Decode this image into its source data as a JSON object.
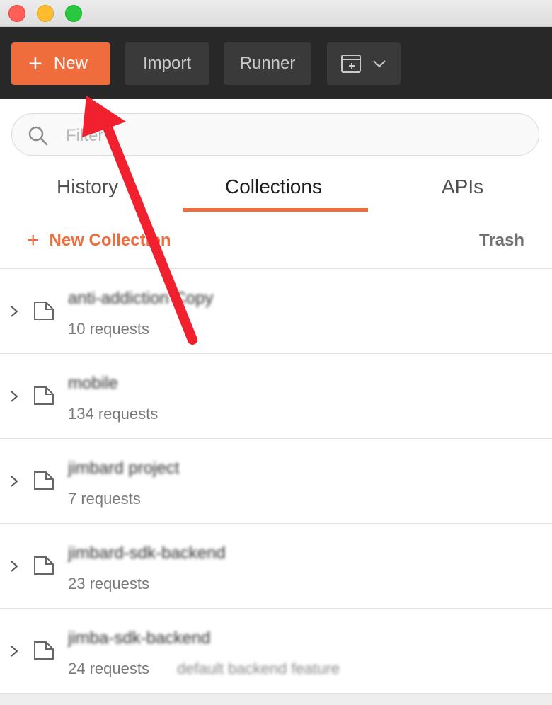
{
  "toolbar": {
    "new_label": "New",
    "import_label": "Import",
    "runner_label": "Runner"
  },
  "search": {
    "placeholder": "Filter"
  },
  "tabs": [
    {
      "label": "History"
    },
    {
      "label": "Collections"
    },
    {
      "label": "APIs"
    }
  ],
  "actions": {
    "new_collection_label": "New Collection",
    "trash_label": "Trash"
  },
  "collections": [
    {
      "name": "anti-addiction Copy",
      "count": "10 requests"
    },
    {
      "name": "mobile",
      "count": "134 requests"
    },
    {
      "name": "jimbard project",
      "count": "7 requests"
    },
    {
      "name": "jimbard-sdk-backend",
      "count": "23 requests"
    },
    {
      "name": "jimba-sdk-backend",
      "count": "24 requests",
      "extra": "default backend feature"
    }
  ],
  "colors": {
    "accent": "#ef6c3c",
    "toolbar_bg": "#282828",
    "annotation_arrow": "#f0202f"
  }
}
